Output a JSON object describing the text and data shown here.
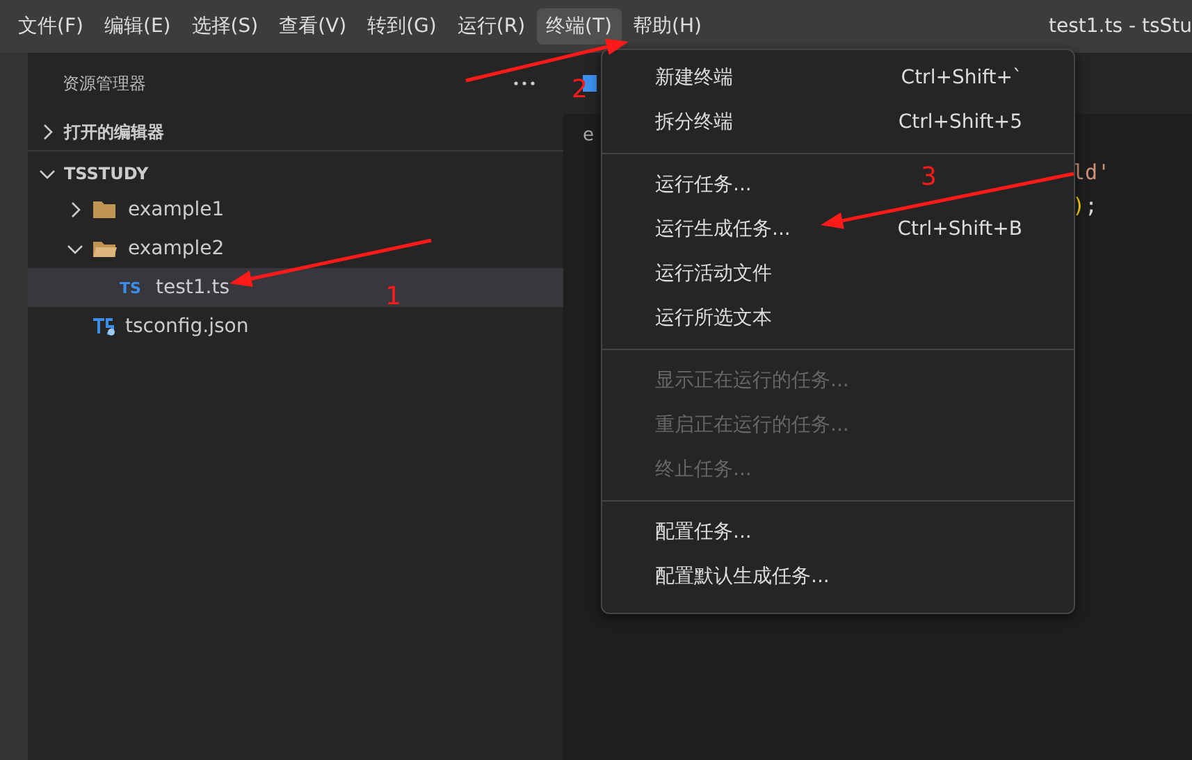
{
  "menu_bar": {
    "items": [
      {
        "label": "文件(F)",
        "selected": false
      },
      {
        "label": "编辑(E)",
        "selected": false
      },
      {
        "label": "选择(S)",
        "selected": false
      },
      {
        "label": "查看(V)",
        "selected": false
      },
      {
        "label": "转到(G)",
        "selected": false
      },
      {
        "label": "运行(R)",
        "selected": false
      },
      {
        "label": "终端(T)",
        "selected": true
      },
      {
        "label": "帮助(H)",
        "selected": false
      }
    ],
    "title": "test1.ts - tsStu"
  },
  "sidebar": {
    "title": "资源管理器",
    "sections": [
      {
        "label": "打开的编辑器",
        "expanded": false
      },
      {
        "label": "TSSTUDY",
        "expanded": true,
        "children": [
          {
            "label": "example1",
            "kind": "folder",
            "expanded": false,
            "selected": false
          },
          {
            "label": "example2",
            "kind": "folder",
            "expanded": true,
            "selected": false,
            "children": [
              {
                "label": "test1.ts",
                "kind": "ts",
                "badge": "TS",
                "selected": true
              }
            ]
          },
          {
            "label": "tsconfig.json",
            "kind": "tsconfig",
            "selected": false
          }
        ]
      }
    ]
  },
  "editor": {
    "breadcrumb": "e",
    "code_lines": [
      [
        {
          "text": "ld'",
          "kind": "string"
        }
      ],
      [
        {
          "text": ")",
          "kind": "bracket"
        },
        {
          "text": ";",
          "kind": "punct"
        }
      ]
    ]
  },
  "menu": {
    "groups": [
      [
        {
          "label": "新建终端",
          "shortcut": "Ctrl+Shift+`",
          "disabled": false
        },
        {
          "label": "拆分终端",
          "shortcut": "Ctrl+Shift+5",
          "disabled": false
        }
      ],
      [
        {
          "label": "运行任务...",
          "disabled": false
        },
        {
          "label": "运行生成任务...",
          "shortcut": "Ctrl+Shift+B",
          "disabled": false
        },
        {
          "label": "运行活动文件",
          "disabled": false
        },
        {
          "label": "运行所选文本",
          "disabled": false
        }
      ],
      [
        {
          "label": "显示正在运行的任务...",
          "disabled": true
        },
        {
          "label": "重启正在运行的任务...",
          "disabled": true
        },
        {
          "label": "终止任务...",
          "disabled": true
        }
      ],
      [
        {
          "label": "配置任务...",
          "disabled": false
        },
        {
          "label": "配置默认生成任务...",
          "disabled": false
        }
      ]
    ]
  },
  "annotations": [
    {
      "label": "1"
    },
    {
      "label": "2"
    },
    {
      "label": "3"
    }
  ]
}
